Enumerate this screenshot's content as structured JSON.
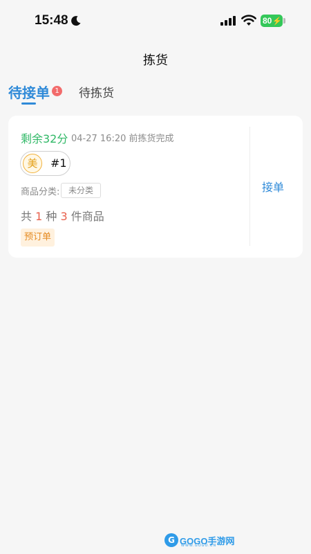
{
  "status_bar": {
    "time": "15:48",
    "moon_icon": "moon-icon",
    "signal_icon": "signal-icon",
    "wifi_icon": "wifi-icon",
    "battery_level": "80",
    "battery_color": "#34c759"
  },
  "nav": {
    "title": "拣货"
  },
  "tabs": [
    {
      "label": "待接单",
      "badge": "1",
      "active": true
    },
    {
      "label": "待拣货",
      "active": false
    }
  ],
  "accent_color": "#2f8ad8",
  "order": {
    "remaining": "剩余32分",
    "deadline": "04-27 16:20 前拣货完成",
    "platform_char": "美",
    "order_number": "#1",
    "category_label": "商品分类:",
    "category_value": "未分类",
    "count_prefix": "共",
    "kinds": "1",
    "kinds_unit": "种",
    "pieces": "3",
    "pieces_unit": "件商品",
    "tag": "预订单",
    "accept_label": "接单"
  },
  "watermark": {
    "logo_char": "G",
    "text": "GOGO手游网",
    "sub": "WWW.GOGO.CN"
  }
}
